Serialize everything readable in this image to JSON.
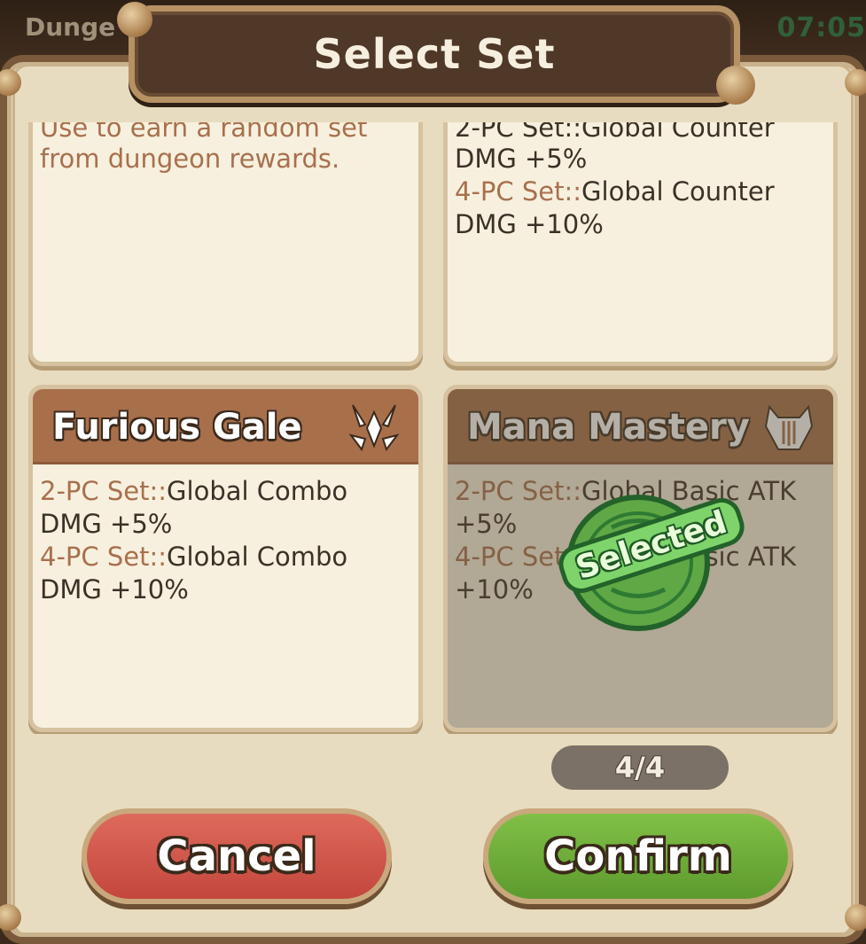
{
  "background": {
    "left_text": "Dunge",
    "right_text": "07:05"
  },
  "dialog": {
    "title": "Select Set"
  },
  "cards": [
    {
      "partial_line": "Use to earn a random set",
      "lines": [
        "from dungeon rewards."
      ]
    },
    {
      "partial_line": "2-PC Set::Global Counter",
      "lines": [
        "DMG +5%"
      ],
      "bonus4_key": "4-PC Set::",
      "bonus4_value": "Global Counter",
      "bonus4_tail": "DMG +10%"
    },
    {
      "name": "Furious Gale",
      "icon": "claw-icon",
      "bonus2_key": "2-PC Set::",
      "bonus2_value": "Global Combo",
      "bonus2_tail": "DMG +5%",
      "bonus4_key": "4-PC Set::",
      "bonus4_value": "Global Combo",
      "bonus4_tail": "DMG +10%"
    },
    {
      "name": "Mana Mastery",
      "icon": "horned-mask-icon",
      "bonus2_key": "2-PC Set::",
      "bonus2_value": "Global Basic ATK",
      "bonus2_tail": "+5%",
      "bonus4_key": "4-PC Set::",
      "bonus4_value": "Global Basic ATK",
      "bonus4_tail": "+10%",
      "stamp": "Selected"
    }
  ],
  "counter": "4/4",
  "buttons": {
    "cancel": "Cancel",
    "confirm": "Confirm"
  },
  "colors": {
    "cancel": "#c4463c",
    "confirm": "#5d9a2e",
    "card_header": "#a86f4b",
    "stamp": "#7ed46a"
  }
}
